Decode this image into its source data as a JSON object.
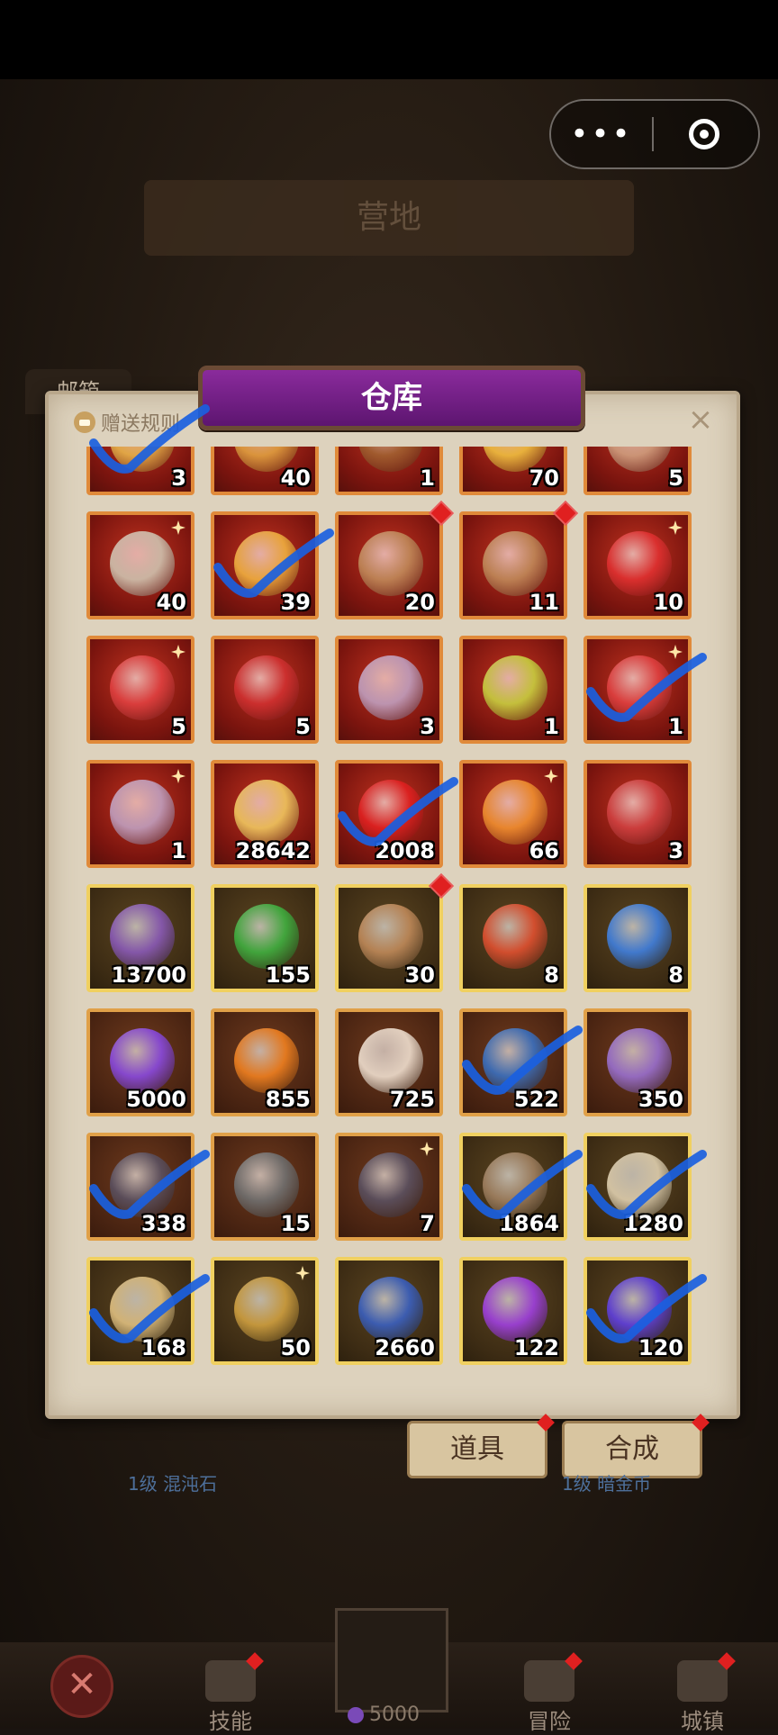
{
  "page": {
    "camp_banner": "营地",
    "mailbox_tab": "邮箱",
    "capsule": {
      "more_icon": "more-dots-icon",
      "target_icon": "target-icon"
    }
  },
  "warehouse": {
    "title": "仓库",
    "gift_rules": "赠送规则",
    "close": "×",
    "items": [
      {
        "count": "3",
        "frame": "red",
        "art": "#e8b34a",
        "checked": true
      },
      {
        "count": "40",
        "frame": "red",
        "art": "#e0a040"
      },
      {
        "count": "1",
        "frame": "red",
        "art": "#a06030"
      },
      {
        "count": "70",
        "frame": "red",
        "art": "#f0c040"
      },
      {
        "count": "5",
        "frame": "red",
        "art": "#d0a080"
      },
      {
        "count": "40",
        "frame": "red",
        "art": "#cfc3b0",
        "sparkle": true
      },
      {
        "count": "39",
        "frame": "red",
        "art": "#f0b040",
        "checked": true
      },
      {
        "count": "20",
        "frame": "red",
        "art": "#c08a5a",
        "reddot": true
      },
      {
        "count": "11",
        "frame": "red",
        "art": "#c08a5a",
        "reddot": true
      },
      {
        "count": "10",
        "frame": "red",
        "art": "#e03030",
        "sparkle": true
      },
      {
        "count": "5",
        "frame": "red",
        "art": "#e04040",
        "sparkle": true
      },
      {
        "count": "5",
        "frame": "red",
        "art": "#d03030"
      },
      {
        "count": "3",
        "frame": "red",
        "art": "#c0a0c0"
      },
      {
        "count": "1",
        "frame": "red",
        "art": "#c8d040"
      },
      {
        "count": "1",
        "frame": "red",
        "art": "#e04040",
        "sparkle": true,
        "checked": true
      },
      {
        "count": "1",
        "frame": "red",
        "art": "#c0a0c0",
        "sparkle": true
      },
      {
        "count": "28642",
        "frame": "red",
        "art": "#f0c860"
      },
      {
        "count": "2008",
        "frame": "red",
        "art": "#e02020",
        "checked": true
      },
      {
        "count": "66",
        "frame": "red",
        "art": "#f09030",
        "sparkle": true
      },
      {
        "count": "3",
        "frame": "red",
        "art": "#d04040"
      },
      {
        "count": "13700",
        "frame": "gold",
        "art": "#8a5ab8"
      },
      {
        "count": "155",
        "frame": "gold",
        "art": "#40b040"
      },
      {
        "count": "30",
        "frame": "gold",
        "art": "#c08a5a",
        "reddot": true
      },
      {
        "count": "8",
        "frame": "gold",
        "art": "#e05030"
      },
      {
        "count": "8",
        "frame": "gold",
        "art": "#4080e0"
      },
      {
        "count": "5000",
        "frame": "brown",
        "art": "#8a4ae0"
      },
      {
        "count": "855",
        "frame": "brown",
        "art": "#f08020"
      },
      {
        "count": "725",
        "frame": "brown",
        "art": "#f0e0d0"
      },
      {
        "count": "522",
        "frame": "brown",
        "art": "#3a70c0",
        "checked": true
      },
      {
        "count": "350",
        "frame": "brown",
        "art": "#9a70d0"
      },
      {
        "count": "338",
        "frame": "brown",
        "art": "#5a5060",
        "checked": true
      },
      {
        "count": "15",
        "frame": "brown",
        "art": "#707070"
      },
      {
        "count": "7",
        "frame": "brown",
        "art": "#5a5060",
        "sparkle": true
      },
      {
        "count": "1864",
        "frame": "gold",
        "art": "#a08060",
        "checked": true
      },
      {
        "count": "1280",
        "frame": "gold",
        "art": "#e0d0b0",
        "checked": true
      },
      {
        "count": "168",
        "frame": "gold",
        "art": "#e0c080",
        "checked": true
      },
      {
        "count": "50",
        "frame": "gold",
        "art": "#d0a040",
        "sparkle": true
      },
      {
        "count": "2660",
        "frame": "gold",
        "art": "#3a60c0"
      },
      {
        "count": "122",
        "frame": "gold",
        "art": "#a040e0"
      },
      {
        "count": "120",
        "frame": "gold",
        "art": "#6040e0",
        "checked": true
      }
    ]
  },
  "tabs": {
    "items_tab": "道具",
    "synth_tab": "合成"
  },
  "levels": {
    "left": "1级 混沌石",
    "right": "1级 暗金币"
  },
  "bottom_nav": {
    "close": "✕",
    "skills": "技能",
    "adventure": "冒险",
    "town": "城镇",
    "currency": "5000"
  },
  "colors": {
    "check_mark": "#1a5fe0",
    "panel_bg": "#ddd2bd",
    "title_purple": "#7b2290"
  }
}
